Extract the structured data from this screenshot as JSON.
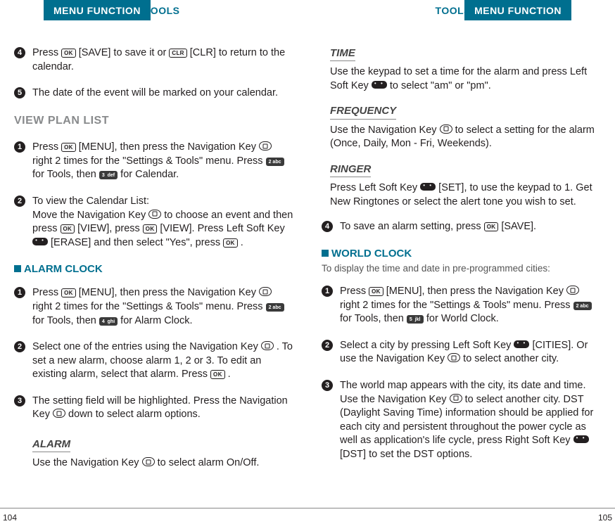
{
  "header": {
    "menu_function": "MENU FUNCTION",
    "tools": "TOOLS"
  },
  "left": {
    "step4": "Press OK [SAVE] to save it or CLR [CLR] to return to the calendar.",
    "step5": "The date of the event will be marked on your calendar.",
    "view_plan_list": "VIEW PLAN LIST",
    "vpl1": "Press OK [MENU], then press the Navigation Key NAV right 2 times for the \"Settings & Tools\" menu. Press 2abc for Tools, then 3def for Calendar.",
    "vpl2": "To view the Calendar List:\nMove the Navigation Key NAV to choose an event and then press OK [VIEW], press OK [VIEW]. Press Left Soft Key SOFT [ERASE] and then select \"Yes\", press OK .",
    "alarm_clock": "ALARM CLOCK",
    "ac1": "Press OK [MENU], then press the Navigation Key NAV right 2 times for the \"Settings & Tools\" menu. Press 2abc for Tools, then 4ghi for Alarm Clock.",
    "ac2": "Select one of the entries using the Navigation Key NAV . To set a new alarm, choose alarm 1, 2 or 3. To edit an existing alarm, select that alarm. Press OK .",
    "ac3": "The setting field will be highlighted. Press the Navigation Key NAV down to select alarm options.",
    "alarm_h": "ALARM",
    "alarm_b": "Use the Navigation Key NAV to select alarm On/Off.",
    "pagenum": "104"
  },
  "right": {
    "time_h": "TIME",
    "time_b": "Use the keypad to set a time for the alarm and press Left Soft Key SOFT to select \"am\" or \"pm\".",
    "freq_h": "FREQUENCY",
    "freq_b": "Use the Navigation Key NAV to select a setting for the alarm (Once, Daily, Mon - Fri, Weekends).",
    "ringer_h": "RINGER",
    "ringer_b": "Press Left Soft Key SOFT [SET], to use the keypad to 1. Get New Ringtones or select the alert tone you wish to set.",
    "step4": "To save an alarm setting, press OK [SAVE].",
    "world_clock": "WORLD CLOCK",
    "wc_intro": "To display the time and date in pre-programmed cities:",
    "wc1": "Press OK [MENU], then press the Navigation Key NAV right 2 times for the \"Settings & Tools\" menu. Press 2abc for Tools, then 5jkl for World Clock.",
    "wc2": "Select a city by pressing Left Soft Key SOFT [CITIES]. Or use the Navigation Key NAV to select another city.",
    "wc3": "The world map appears with the city, its date and time. Use the Navigation Key NAV to select another city. DST (Daylight Saving Time) information should be applied for each city and persistent throughout the power cycle as well as application's life cycle, press Right Soft Key SOFT [DST] to set the DST options.",
    "pagenum": "105"
  }
}
